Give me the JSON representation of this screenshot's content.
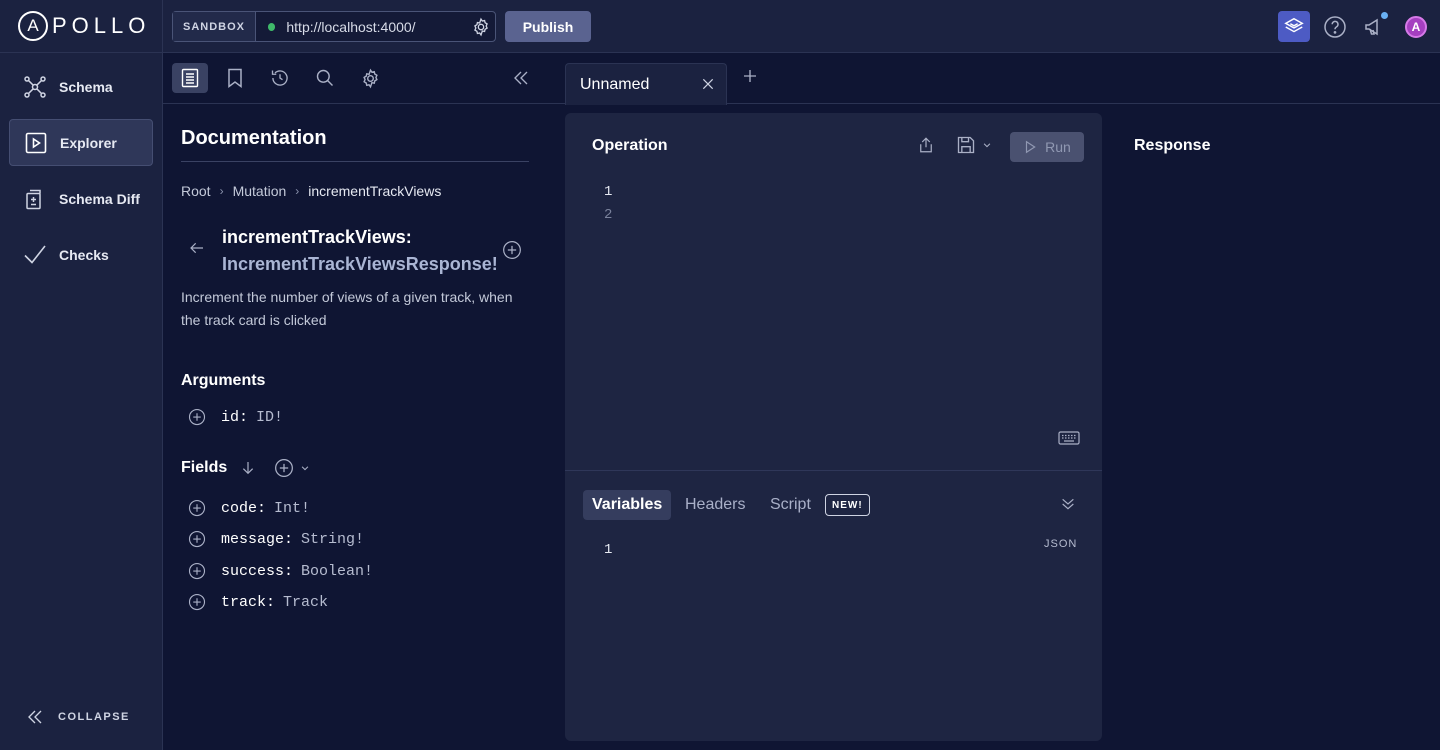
{
  "topbar": {
    "logo_text": "POLLO",
    "logo_letter": "A",
    "sandbox_label": "SANDBOX",
    "endpoint_url": "http://localhost:4000/",
    "publish_label": "Publish",
    "avatar_letter": "A"
  },
  "nav": {
    "items": [
      {
        "label": "Schema"
      },
      {
        "label": "Explorer"
      },
      {
        "label": "Schema Diff"
      },
      {
        "label": "Checks"
      }
    ],
    "collapse_label": "COLLAPSE"
  },
  "doc": {
    "title": "Documentation",
    "breadcrumb": [
      "Root",
      "Mutation",
      "incrementTrackViews"
    ],
    "field_name": "incrementTrackViews:",
    "field_type": "IncrementTrackViewsResponse!",
    "description": "Increment the number of views of a given track, when the track card is clicked",
    "arguments_title": "Arguments",
    "arguments": [
      {
        "name": "id:",
        "type": "ID!"
      }
    ],
    "fields_title": "Fields",
    "fields": [
      {
        "name": "code:",
        "type": "Int!"
      },
      {
        "name": "message:",
        "type": "String!"
      },
      {
        "name": "success:",
        "type": "Boolean!"
      },
      {
        "name": "track:",
        "type": "Track"
      }
    ]
  },
  "tabs": [
    {
      "label": "Unnamed"
    }
  ],
  "operation": {
    "title": "Operation",
    "run_label": "Run",
    "line_numbers": [
      "1",
      "2"
    ],
    "variables_tabs": [
      "Variables",
      "Headers",
      "Script"
    ],
    "new_badge": "NEW!",
    "variables_line_numbers": [
      "1"
    ],
    "json_label": "JSON"
  },
  "response": {
    "title": "Response"
  },
  "colors": {
    "background": "#0f1533",
    "panel": "#1b2240",
    "accent": "#4d5bc4",
    "status_ok": "#3fb96a",
    "avatar": "#a53fc0"
  }
}
